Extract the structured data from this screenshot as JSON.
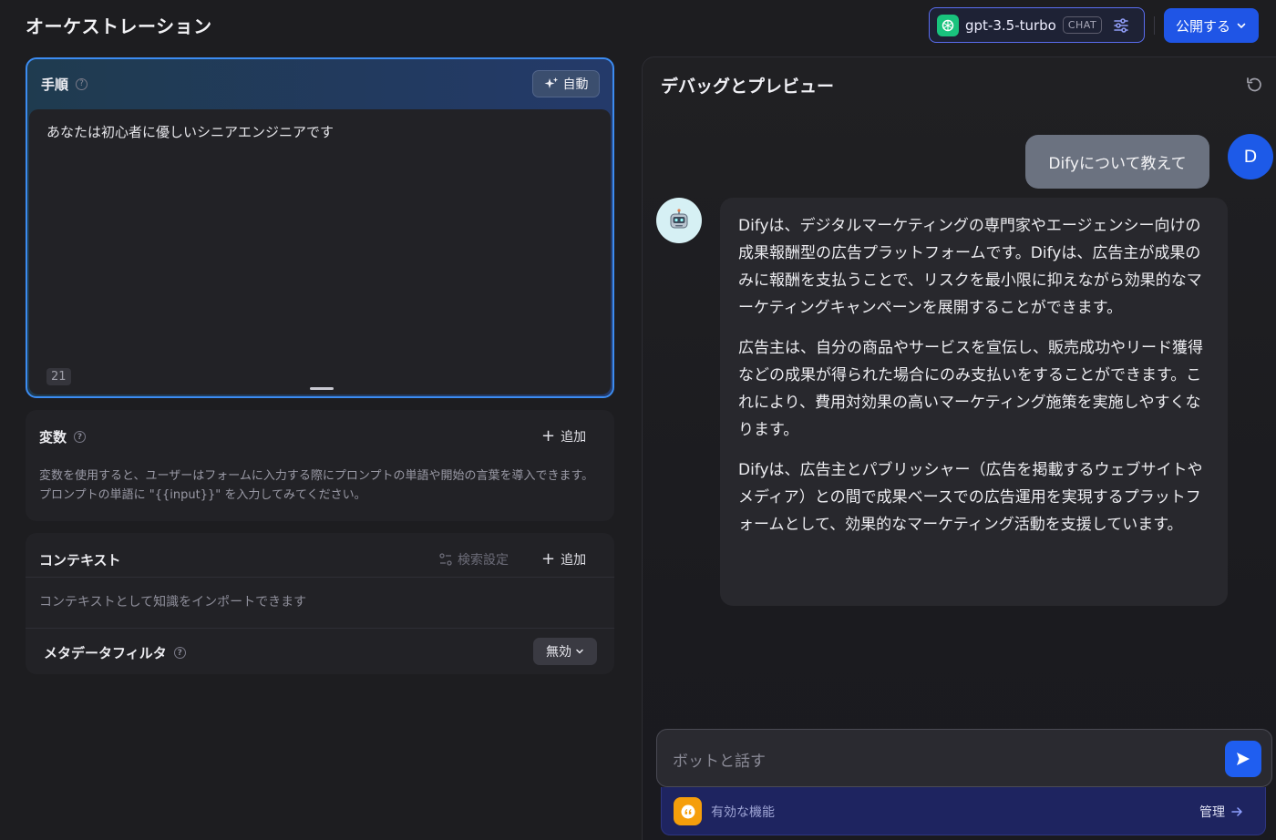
{
  "header": {
    "title": "オーケストレーション",
    "model_name": "gpt-3.5-turbo",
    "model_mode": "CHAT",
    "publish_label": "公開する"
  },
  "prompt": {
    "title": "手順",
    "auto_label": "自動",
    "text": "あなたは初心者に優しいシニアエンジニアです",
    "char_count": "21"
  },
  "variables": {
    "title": "変数",
    "add_label": "追加",
    "description": "変数を使用すると、ユーザーはフォームに入力する際にプロンプトの単語や開始の言葉を導入できます。プロンプトの単語に \"{{input}}\" を入力してみてください。"
  },
  "context": {
    "title": "コンテキスト",
    "search_settings_label": "検索設定",
    "add_label": "追加",
    "description": "コンテキストとして知識をインポートできます",
    "metadata_filter_label": "メタデータフィルタ",
    "metadata_filter_value": "無効"
  },
  "debug": {
    "title": "デバッグとプレビュー",
    "user_avatar": "D",
    "user_message": "Difyについて教えて",
    "bot_paragraphs": [
      "Difyは、デジタルマーケティングの専門家やエージェンシー向けの成果報酬型の広告プラットフォームです。Difyは、広告主が成果のみに報酬を支払うことで、リスクを最小限に抑えながら効果的なマーケティングキャンペーンを展開することができます。",
      "広告主は、自分の商品やサービスを宣伝し、販売成功やリード獲得などの成果が得られた場合にのみ支払いをすることができます。これにより、費用対効果の高いマーケティング施策を実施しやすくなります。",
      "Difyは、広告主とパブリッシャー（広告を掲載するウェブサイトやメディア）との間で成果ベースでの広告運用を実現するプラットフォームとして、効果的なマーケティング活動を支援しています。"
    ],
    "input_placeholder": "ボットと話す",
    "features_label": "有効な機能",
    "manage_label": "管理"
  },
  "colors": {
    "accent": "#1f55e6",
    "prompt_border": "#3c8cf2",
    "model_logo": "#19c37d",
    "feature_icon": "#f59e0b"
  },
  "icons": [
    "help-icon",
    "sparkle-icon",
    "tune-icon",
    "chevron-down-icon",
    "plus-icon",
    "search-settings-icon",
    "refresh-icon",
    "robot-icon",
    "send-icon",
    "quote-icon",
    "arrow-right-icon",
    "openai-icon"
  ]
}
